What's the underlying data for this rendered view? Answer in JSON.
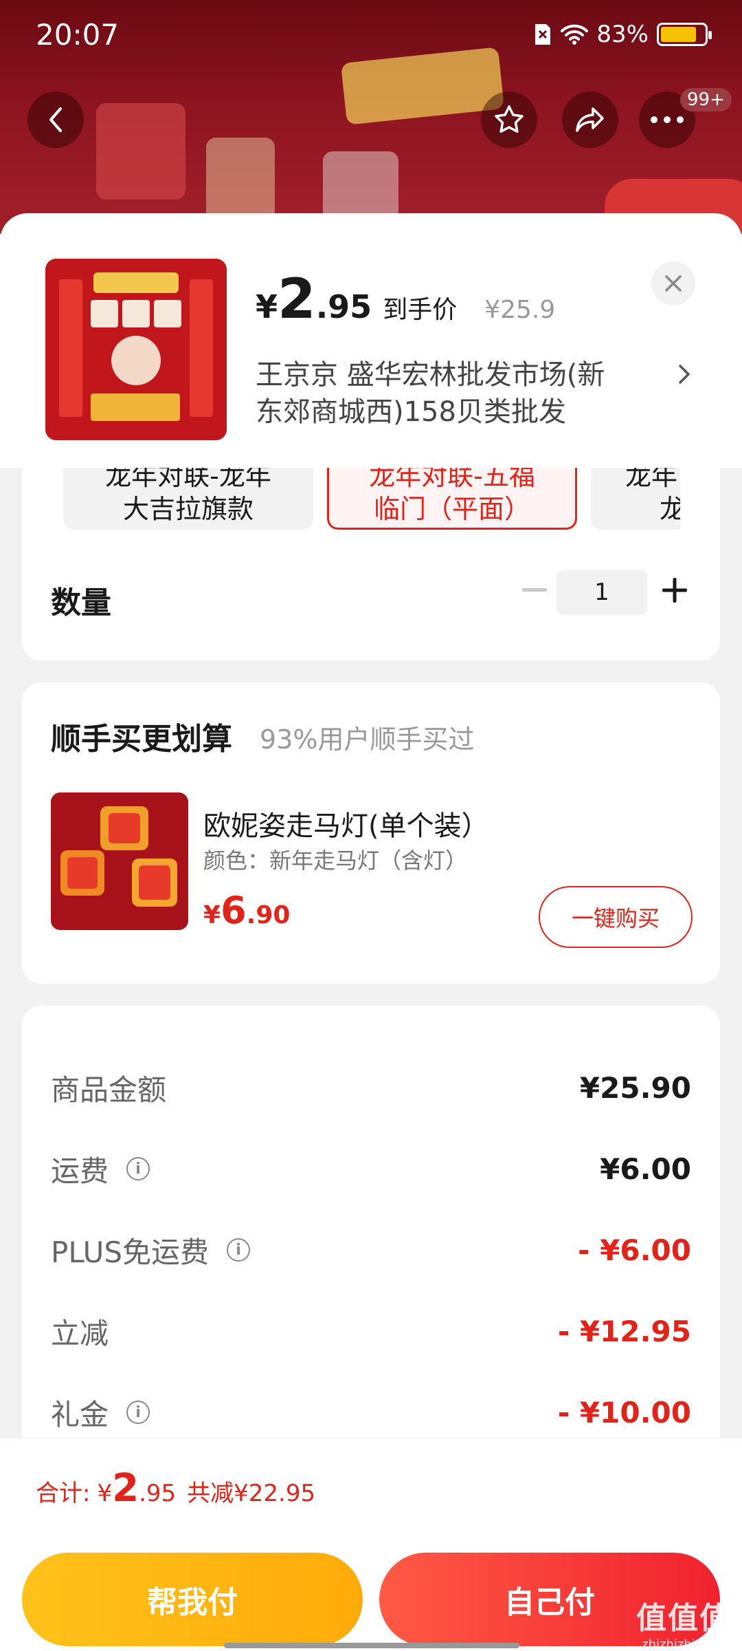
{
  "status_bar": {
    "time": "20:07",
    "battery": "83%",
    "battery_level": 0.83
  },
  "top_nav": {
    "back_icon": "chevron-left-icon",
    "favorite_icon": "star-icon",
    "share_icon": "share-icon",
    "more_icon": "more-dots-icon",
    "badge": "99+"
  },
  "colors": {
    "accent": "#e2231a",
    "help_pay": "#ffb414",
    "self_pay": "#f0222e"
  },
  "product": {
    "price_symbol": "¥",
    "price_int": "2",
    "price_dec": ".95",
    "price_label": "到手价",
    "original_price": "¥25.9",
    "shop_line1": "王京京  盛华宏林批发市场(新",
    "shop_line2": "东郊商城西)158贝类批发"
  },
  "specs": {
    "options": [
      {
        "line1": "龙年对联-龙年",
        "line2": "大吉拉旗款",
        "selected": false
      },
      {
        "line1": "龙年对联-五福",
        "line2": "临门（平面）",
        "selected": true
      },
      {
        "line1": "龙年",
        "line2": "龙",
        "selected": false
      }
    ]
  },
  "quantity": {
    "label": "数量",
    "value": "1"
  },
  "addon": {
    "title": "顺手买更划算",
    "subtitle": "93%用户顺手买过",
    "name": "欧妮姿走马灯(单个装）",
    "attr": "颜色：新年走马灯（含灯）",
    "price_symbol": "¥",
    "price_int": "6",
    "price_dec": ".90",
    "button": "一键购买"
  },
  "fees": [
    {
      "label": "商品金额",
      "value": "¥25.90",
      "info": false,
      "discount": false
    },
    {
      "label": "运费",
      "value": "¥6.00",
      "info": true,
      "discount": false
    },
    {
      "label": "PLUS免运费",
      "value": "- ¥6.00",
      "info": true,
      "discount": true
    },
    {
      "label": "立减",
      "value": "- ¥12.95",
      "info": false,
      "discount": true
    },
    {
      "label": "礼金",
      "value": "- ¥10.00",
      "info": true,
      "discount": true
    }
  ],
  "footer": {
    "total_label": "合计:",
    "total_symbol": "¥",
    "total_int": "2",
    "total_dec": ".95",
    "saved": "共减¥22.95",
    "help_pay": "帮我付",
    "self_pay": "自己付"
  },
  "watermark": {
    "line1": "值值值",
    "line2": "zhizhizhi.com"
  }
}
